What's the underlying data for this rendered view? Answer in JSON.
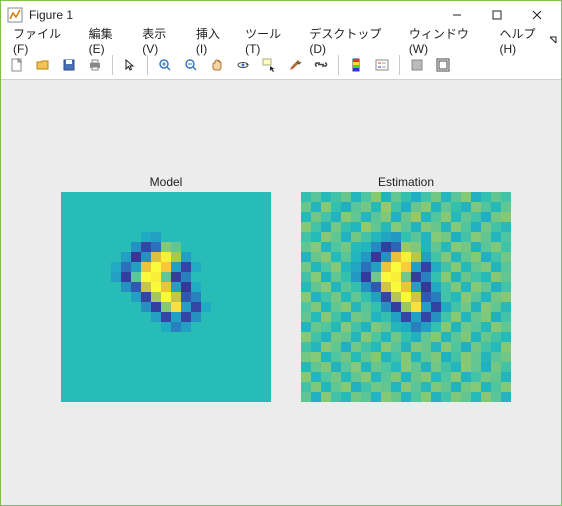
{
  "window": {
    "title": "Figure 1"
  },
  "menu": {
    "file": "ファイル(F)",
    "edit": "編集(E)",
    "view": "表示(V)",
    "insert": "挿入(I)",
    "tools": "ツール(T)",
    "desktop": "デスクトップ(D)",
    "window": "ウィンドウ(W)",
    "help": "ヘルプ(H)"
  },
  "toolbar": {
    "new": "New Figure",
    "open": "Open",
    "save": "Save",
    "print": "Print",
    "pointer": "Edit Plot",
    "zoom_in": "Zoom In",
    "zoom_out": "Zoom Out",
    "pan": "Pan",
    "rotate": "Rotate 3D",
    "datacursor": "Data Cursor",
    "brush": "Brush",
    "link": "Link Plot",
    "colorbar": "Insert Colorbar",
    "legend": "Insert Legend",
    "hide": "Hide Plot Tools",
    "show": "Show Plot Tools"
  },
  "chart_data": [
    {
      "type": "heatmap",
      "title": "Model",
      "grid_size": 21,
      "clim": [
        -1,
        1
      ],
      "colormap": "parula",
      "data_rows": [
        [
          0,
          0,
          0,
          0,
          0,
          0,
          0,
          0,
          0,
          0,
          0,
          0,
          0,
          0,
          0,
          0,
          0,
          0,
          0,
          0,
          0
        ],
        [
          0,
          0,
          0,
          0,
          0,
          0,
          0,
          0,
          0,
          0,
          0,
          0,
          0,
          0,
          0,
          0,
          0,
          0,
          0,
          0,
          0
        ],
        [
          0,
          0,
          0,
          0,
          0,
          0,
          0,
          0,
          0,
          0,
          0,
          0,
          0,
          0,
          0,
          0,
          0,
          0,
          0,
          0,
          0
        ],
        [
          0,
          0,
          0,
          0,
          0,
          0,
          0,
          0,
          0,
          0,
          0,
          0,
          0,
          0,
          0,
          0,
          0,
          0,
          0,
          0,
          0
        ],
        [
          0,
          0,
          0,
          0,
          0,
          0,
          0,
          0,
          -0.2,
          -0.3,
          0,
          0,
          0,
          0,
          0,
          0,
          0,
          0,
          0,
          0,
          0
        ],
        [
          0,
          0,
          0,
          0,
          0,
          0,
          0,
          -0.4,
          -0.8,
          -0.6,
          0.3,
          0.2,
          0,
          0,
          0,
          0,
          0,
          0,
          0,
          0,
          0
        ],
        [
          0,
          0,
          0,
          0,
          0,
          0,
          -0.3,
          -0.9,
          -0.4,
          0.6,
          0.95,
          0.4,
          -0.3,
          0,
          0,
          0,
          0,
          0,
          0,
          0,
          0
        ],
        [
          0,
          0,
          0,
          0,
          0,
          -0.2,
          -0.6,
          -0.3,
          0.7,
          1,
          0.8,
          -0.3,
          -0.8,
          -0.2,
          0,
          0,
          0,
          0,
          0,
          0,
          0
        ],
        [
          0,
          0,
          0,
          0,
          0,
          -0.3,
          -0.85,
          0.2,
          1,
          0.95,
          0.2,
          -0.85,
          -0.5,
          0,
          0,
          0,
          0,
          0,
          0,
          0,
          0
        ],
        [
          0,
          0,
          0,
          0,
          0,
          0,
          -0.4,
          -0.7,
          0.5,
          1,
          0.7,
          -0.3,
          -0.9,
          -0.2,
          0,
          0,
          0,
          0,
          0,
          0,
          0
        ],
        [
          0,
          0,
          0,
          0,
          0,
          0,
          0,
          -0.3,
          -0.8,
          0.4,
          1,
          0.5,
          -0.7,
          -0.5,
          0,
          0,
          0,
          0,
          0,
          0,
          0
        ],
        [
          0,
          0,
          0,
          0,
          0,
          0,
          0,
          0,
          -0.4,
          -0.85,
          0.3,
          0.9,
          -0.3,
          -0.8,
          -0.2,
          0,
          0,
          0,
          0,
          0,
          0
        ],
        [
          0,
          0,
          0,
          0,
          0,
          0,
          0,
          0,
          0,
          -0.3,
          -0.8,
          -0.3,
          -0.8,
          -0.4,
          0,
          0,
          0,
          0,
          0,
          0,
          0
        ],
        [
          0,
          0,
          0,
          0,
          0,
          0,
          0,
          0,
          0,
          0,
          -0.2,
          -0.5,
          -0.3,
          0,
          0,
          0,
          0,
          0,
          0,
          0,
          0
        ],
        [
          0,
          0,
          0,
          0,
          0,
          0,
          0,
          0,
          0,
          0,
          0,
          0,
          0,
          0,
          0,
          0,
          0,
          0,
          0,
          0,
          0
        ],
        [
          0,
          0,
          0,
          0,
          0,
          0,
          0,
          0,
          0,
          0,
          0,
          0,
          0,
          0,
          0,
          0,
          0,
          0,
          0,
          0,
          0
        ],
        [
          0,
          0,
          0,
          0,
          0,
          0,
          0,
          0,
          0,
          0,
          0,
          0,
          0,
          0,
          0,
          0,
          0,
          0,
          0,
          0,
          0
        ],
        [
          0,
          0,
          0,
          0,
          0,
          0,
          0,
          0,
          0,
          0,
          0,
          0,
          0,
          0,
          0,
          0,
          0,
          0,
          0,
          0,
          0
        ],
        [
          0,
          0,
          0,
          0,
          0,
          0,
          0,
          0,
          0,
          0,
          0,
          0,
          0,
          0,
          0,
          0,
          0,
          0,
          0,
          0,
          0
        ],
        [
          0,
          0,
          0,
          0,
          0,
          0,
          0,
          0,
          0,
          0,
          0,
          0,
          0,
          0,
          0,
          0,
          0,
          0,
          0,
          0,
          0
        ],
        [
          0,
          0,
          0,
          0,
          0,
          0,
          0,
          0,
          0,
          0,
          0,
          0,
          0,
          0,
          0,
          0,
          0,
          0,
          0,
          0,
          0
        ]
      ]
    },
    {
      "type": "heatmap",
      "title": "Estimation",
      "grid_size": 21,
      "clim": [
        -1,
        1
      ],
      "colormap": "parula",
      "data_rows": [
        [
          0.05,
          0.18,
          -0.05,
          0.1,
          0.22,
          -0.1,
          0.15,
          0.3,
          -0.12,
          0.2,
          0.05,
          -0.18,
          0.1,
          0.25,
          -0.08,
          0.18,
          0.3,
          -0.15,
          0.05,
          0.2,
          0.1
        ],
        [
          0.22,
          -0.1,
          0.3,
          0.05,
          -0.15,
          0.18,
          0.25,
          -0.05,
          0.35,
          0.1,
          -0.18,
          0.22,
          0.3,
          -0.1,
          0.2,
          0.05,
          -0.12,
          0.28,
          0.15,
          -0.05,
          0.2
        ],
        [
          -0.05,
          0.25,
          0.1,
          -0.12,
          0.3,
          0.2,
          -0.08,
          0.18,
          0.28,
          -0.15,
          0.22,
          0.35,
          -0.1,
          0.15,
          0.3,
          -0.05,
          0.2,
          0.1,
          -0.18,
          0.25,
          0.3
        ],
        [
          0.3,
          0.1,
          -0.15,
          0.25,
          0.05,
          -0.1,
          0.35,
          0.2,
          -0.05,
          0.3,
          0.18,
          -0.12,
          0.28,
          0.22,
          -0.08,
          0.3,
          0.15,
          -0.15,
          0.25,
          0.1,
          -0.05
        ],
        [
          0.1,
          -0.05,
          0.3,
          0.2,
          -0.12,
          0.25,
          0.1,
          -0.08,
          -0.25,
          -0.35,
          0.05,
          0.18,
          -0.1,
          0.3,
          0.25,
          -0.15,
          0.1,
          0.3,
          0.2,
          -0.08,
          0.15
        ],
        [
          0.2,
          0.3,
          -0.1,
          0.15,
          0.25,
          -0.05,
          -0.1,
          -0.45,
          -0.85,
          -0.65,
          0.35,
          0.28,
          -0.1,
          0.2,
          -0.05,
          0.3,
          0.25,
          -0.12,
          0.18,
          0.28,
          0.1
        ],
        [
          -0.12,
          0.22,
          0.3,
          -0.05,
          0.18,
          -0.1,
          -0.35,
          -0.9,
          -0.4,
          0.65,
          0.95,
          0.45,
          -0.3,
          0.1,
          0.28,
          -0.08,
          0.2,
          0.3,
          -0.15,
          0.1,
          0.25
        ],
        [
          0.25,
          -0.1,
          0.15,
          0.3,
          -0.08,
          -0.25,
          -0.6,
          -0.3,
          0.7,
          1,
          0.82,
          -0.3,
          -0.82,
          -0.2,
          0.1,
          0.3,
          -0.05,
          0.2,
          0.28,
          -0.1,
          0.18
        ],
        [
          0.1,
          0.3,
          -0.15,
          0.2,
          0.05,
          -0.35,
          -0.88,
          0.25,
          1,
          0.95,
          0.25,
          -0.85,
          -0.5,
          0.05,
          0.3,
          -0.12,
          0.22,
          0.1,
          -0.05,
          0.3,
          0.2
        ],
        [
          -0.05,
          0.2,
          0.3,
          -0.1,
          0.18,
          0.05,
          -0.4,
          -0.7,
          0.55,
          1,
          0.72,
          -0.3,
          -0.9,
          -0.22,
          0.1,
          0.28,
          -0.08,
          0.3,
          0.2,
          -0.15,
          0.1
        ],
        [
          0.3,
          -0.12,
          0.1,
          0.25,
          -0.05,
          0.2,
          0.05,
          -0.3,
          -0.8,
          0.45,
          1,
          0.55,
          -0.7,
          -0.52,
          0.1,
          -0.05,
          0.3,
          0.18,
          -0.1,
          0.25,
          0.3
        ],
        [
          0.15,
          0.28,
          -0.1,
          0.2,
          0.3,
          -0.08,
          0.18,
          0.05,
          -0.4,
          -0.85,
          0.35,
          0.9,
          -0.3,
          -0.82,
          -0.2,
          0.1,
          0.25,
          -0.12,
          0.3,
          0.2,
          -0.05
        ],
        [
          0.2,
          -0.05,
          0.3,
          0.1,
          -0.15,
          0.25,
          0.2,
          -0.1,
          0.05,
          -0.3,
          -0.8,
          -0.3,
          -0.8,
          -0.4,
          0.1,
          0.3,
          -0.08,
          0.2,
          0.28,
          -0.15,
          0.1
        ],
        [
          -0.1,
          0.22,
          0.15,
          -0.05,
          0.3,
          0.1,
          -0.12,
          0.28,
          0.2,
          -0.08,
          -0.2,
          -0.5,
          -0.3,
          0.05,
          0.3,
          -0.1,
          0.25,
          0.18,
          -0.05,
          0.3,
          0.2
        ],
        [
          0.3,
          0.1,
          -0.12,
          0.25,
          0.2,
          -0.08,
          0.3,
          0.15,
          -0.1,
          0.25,
          0.05,
          -0.15,
          0.2,
          0.3,
          -0.08,
          0.18,
          0.28,
          -0.1,
          0.22,
          0.1,
          -0.05
        ],
        [
          0.1,
          -0.08,
          0.3,
          0.2,
          -0.15,
          0.25,
          0.1,
          -0.05,
          0.3,
          0.18,
          -0.12,
          0.28,
          0.22,
          -0.08,
          0.3,
          0.15,
          -0.15,
          0.25,
          0.1,
          -0.05,
          0.3
        ],
        [
          0.25,
          0.3,
          -0.1,
          0.15,
          0.25,
          -0.05,
          0.2,
          0.3,
          -0.1,
          0.1,
          0.3,
          -0.08,
          0.2,
          0.28,
          -0.15,
          0.1,
          0.3,
          0.2,
          -0.08,
          0.18,
          0.25
        ],
        [
          -0.05,
          0.2,
          0.28,
          -0.12,
          0.18,
          0.3,
          -0.1,
          0.22,
          0.15,
          -0.05,
          0.3,
          0.2,
          -0.12,
          0.25,
          0.1,
          -0.08,
          0.3,
          0.2,
          -0.15,
          0.25,
          0.1
        ],
        [
          0.3,
          -0.1,
          0.15,
          0.25,
          -0.05,
          0.2,
          0.3,
          -0.08,
          0.18,
          0.28,
          -0.1,
          0.22,
          0.3,
          -0.05,
          0.15,
          0.3,
          -0.12,
          0.1,
          0.25,
          0.2,
          -0.08
        ],
        [
          0.1,
          0.28,
          -0.08,
          0.2,
          0.3,
          -0.15,
          0.1,
          0.25,
          0.2,
          -0.1,
          0.3,
          0.18,
          -0.05,
          0.28,
          0.2,
          -0.12,
          0.25,
          0.3,
          -0.1,
          0.15,
          0.3
        ],
        [
          0.2,
          -0.15,
          0.3,
          0.1,
          -0.05,
          0.25,
          0.18,
          -0.1,
          0.3,
          0.22,
          -0.08,
          0.15,
          0.3,
          -0.12,
          0.1,
          0.28,
          0.2,
          -0.05,
          0.3,
          0.18,
          -0.1
        ]
      ]
    }
  ]
}
